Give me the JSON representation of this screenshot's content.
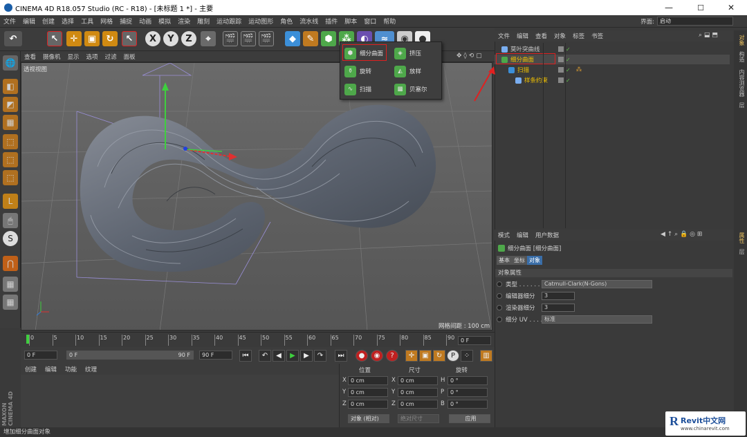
{
  "window": {
    "title": "CINEMA 4D R18.057 Studio (RC - R18) - [未标题 1 *] - 主要",
    "min": "—",
    "max": "☐",
    "close": "✕"
  },
  "menubar": [
    "文件",
    "编辑",
    "创建",
    "选择",
    "工具",
    "网格",
    "捕捉",
    "动画",
    "模拟",
    "渲染",
    "雕刻",
    "运动跟踪",
    "运动图形",
    "角色",
    "流水线",
    "插件",
    "脚本",
    "窗口",
    "帮助"
  ],
  "layout": {
    "label": "界面:",
    "value": "启动"
  },
  "toolbar": {
    "x": "X",
    "y": "Y",
    "z": "Z"
  },
  "viewport": {
    "menu": [
      "查看",
      "摄像机",
      "显示",
      "选项",
      "过滤",
      "面板"
    ],
    "label": "透视视图",
    "grid": "网格间距 : 100 cm"
  },
  "popup": {
    "items": [
      {
        "label": "细分曲面",
        "icon": "subdivision-surface-icon"
      },
      {
        "label": "挤压",
        "icon": "extrude-icon"
      },
      {
        "label": "旋转",
        "icon": "lathe-icon"
      },
      {
        "label": "放样",
        "icon": "loft-icon"
      },
      {
        "label": "扫描",
        "icon": "sweep-icon"
      },
      {
        "label": "贝塞尔",
        "icon": "bezier-icon"
      }
    ]
  },
  "timeline": {
    "ticks": [
      "0",
      "5",
      "10",
      "15",
      "20",
      "25",
      "30",
      "35",
      "40",
      "45",
      "50",
      "55",
      "60",
      "65",
      "70",
      "75",
      "80",
      "85",
      "90"
    ],
    "current": "0 F"
  },
  "transport": {
    "start": "0 F",
    "mid_start": "0 F",
    "mid_end": "90 F",
    "end": "90 F"
  },
  "material": {
    "menu": [
      "创建",
      "编辑",
      "功能",
      "纹理"
    ]
  },
  "coords": {
    "headers": [
      "位置",
      "尺寸",
      "旋转"
    ],
    "rows": [
      {
        "a": "X",
        "av": "0 cm",
        "b": "X",
        "bv": "0 cm",
        "c": "H",
        "cv": "0 °"
      },
      {
        "a": "Y",
        "av": "0 cm",
        "b": "Y",
        "bv": "0 cm",
        "c": "P",
        "cv": "0 °"
      },
      {
        "a": "Z",
        "av": "0 cm",
        "b": "Z",
        "bv": "0 cm",
        "c": "B",
        "cv": "0 °"
      }
    ],
    "mode": "对象 (相对)",
    "size_mode": "绝对尺寸",
    "apply": "应用"
  },
  "objects": {
    "menu": [
      "文件",
      "编辑",
      "查看",
      "对象",
      "标签",
      "书签"
    ],
    "tree": [
      {
        "name": "莫叶突曲线",
        "color": "#c8c8c8",
        "indent": 0
      },
      {
        "name": "细分曲面",
        "color": "#f2c200",
        "indent": 0
      },
      {
        "name": "扫描",
        "color": "#f2c200",
        "indent": 1
      },
      {
        "name": "样条约束",
        "color": "#f2c200",
        "indent": 2
      }
    ]
  },
  "attributes": {
    "menu": [
      "模式",
      "编辑",
      "用户数据"
    ],
    "title": "细分曲面 [细分曲面]",
    "tabs": [
      "基本",
      "坐标",
      "对象"
    ],
    "section": "对象属性",
    "props": [
      {
        "label": "类型 . . . . . . .",
        "value": "Catmull-Clark(N-Gons)",
        "dropdown": true
      },
      {
        "label": "编辑器细分",
        "value": "3",
        "dropdown": false
      },
      {
        "label": "渲染器细分",
        "value": "3",
        "dropdown": false
      },
      {
        "label": "细分 UV . . . . .",
        "value": "标准",
        "dropdown": true
      }
    ]
  },
  "sidetabs": [
    "对象",
    "构造",
    "内容浏览器",
    "层"
  ],
  "sidetabs_attr": [
    "属性",
    "层"
  ],
  "status": "增加细分曲面对象",
  "maxon": "MAXON CINEMA 4D",
  "watermark": {
    "brand": "Revit中文网",
    "url": "www.chinarevit.com"
  },
  "colors": {
    "accent": "#e02020",
    "selected": "#f2c200",
    "green": "#5fc04a",
    "blue": "#1f8fe0"
  }
}
